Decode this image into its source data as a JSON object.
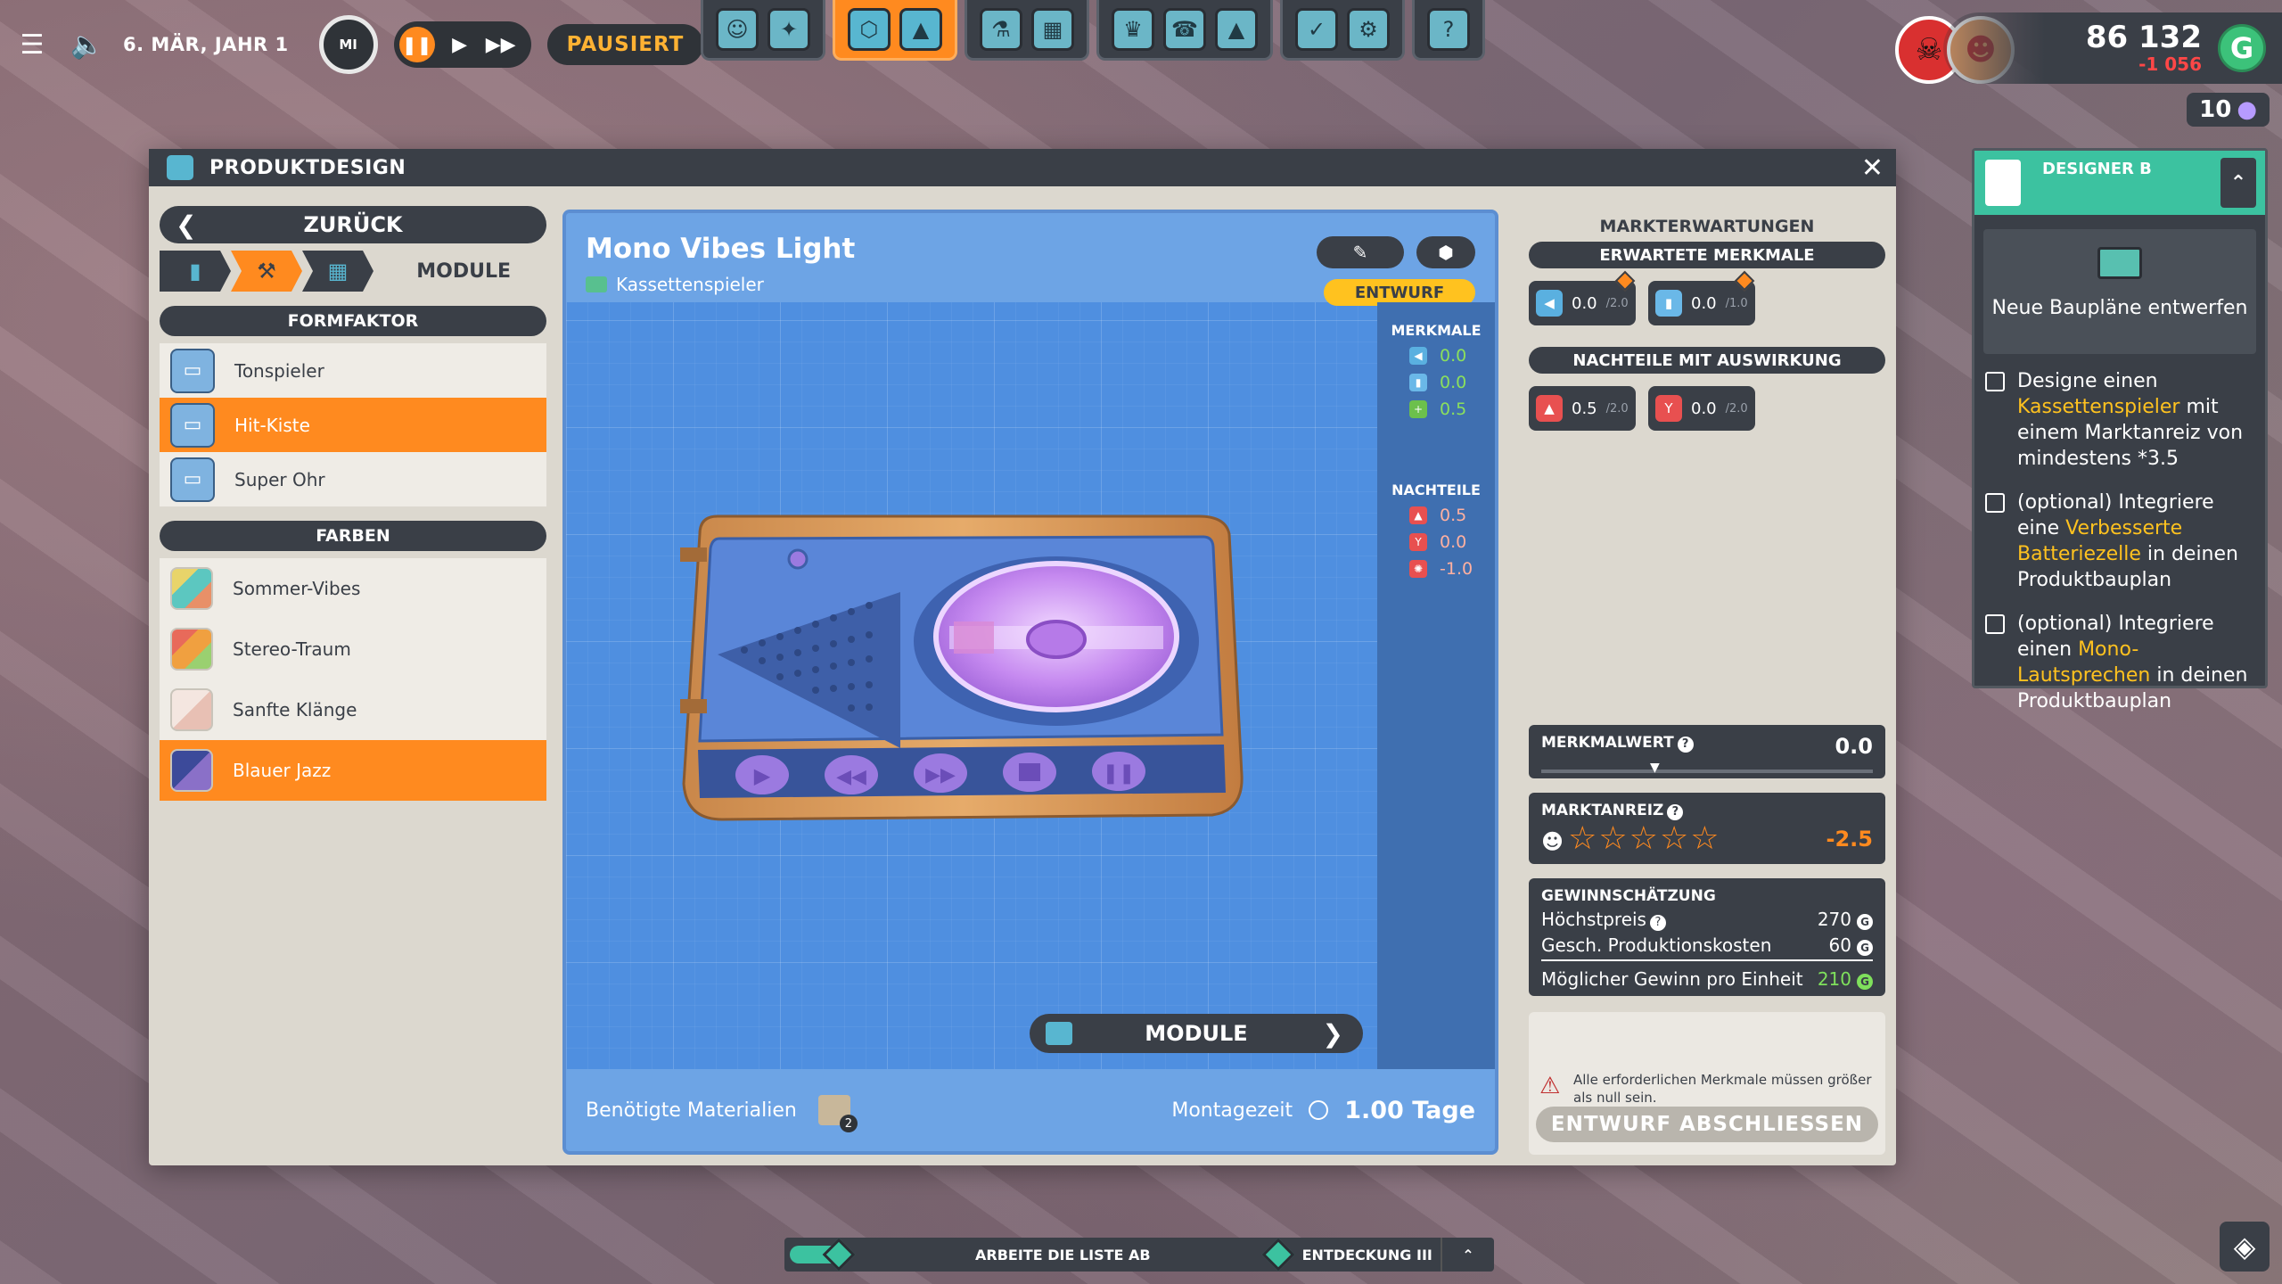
{
  "topbar": {
    "date": "6. MÄR, JAHR 1",
    "day": "MI",
    "paused_label": "PAUSIERT",
    "money": "86 132",
    "money_delta": "-1 056",
    "currency": "G",
    "mood": "10"
  },
  "window": {
    "title": "PRODUKTDESIGN"
  },
  "left": {
    "back": "ZURÜCK",
    "modes_label": "MODULE",
    "formfactor_head": "FORMFAKTOR",
    "formfactors": [
      {
        "label": "Tonspieler"
      },
      {
        "label": "Hit-Kiste"
      },
      {
        "label": "Super Ohr"
      }
    ],
    "colors_head": "FARBEN",
    "colors": [
      {
        "label": "Sommer-Vibes"
      },
      {
        "label": "Stereo-Traum"
      },
      {
        "label": "Sanfte Klänge"
      },
      {
        "label": "Blauer Jazz"
      }
    ]
  },
  "product": {
    "name": "Mono Vibes Light",
    "type": "Kassettenspieler",
    "status": "ENTWURF",
    "features_title": "MERKMALE",
    "features": [
      "0.0",
      "0.0",
      "0.5"
    ],
    "drawbacks_title": "NACHTEILE",
    "drawbacks": [
      "0.5",
      "0.0",
      "-1.0"
    ],
    "modules_btn": "MODULE",
    "materials_label": "Benötigte Materialien",
    "materials_count": "2",
    "assembly_label": "Montagezeit",
    "assembly_value": "1.00 Tage"
  },
  "market": {
    "title": "MARKTERWARTUNGEN",
    "expected_head": "ERWARTETE MERKMALE",
    "expected": [
      {
        "val": "0.0",
        "max": "/2.0"
      },
      {
        "val": "0.0",
        "max": "/1.0"
      }
    ],
    "drawbacks_head": "NACHTEILE MIT AUSWIRKUNG",
    "drawbacks": [
      {
        "val": "0.5",
        "max": "/2.0"
      },
      {
        "val": "0.0",
        "max": "/2.0"
      }
    ],
    "feature_value_label": "MERKMALWERT",
    "feature_value": "0.0",
    "appeal_label": "MARKTANREIZ",
    "appeal_value": "-2.5",
    "appeal_stars": 0,
    "profit_head": "GEWINNSCHÄTZUNG",
    "max_price_label": "Höchstpreis",
    "max_price": "270",
    "prod_cost_label": "Gesch. Produktionskosten",
    "prod_cost": "60",
    "profit_label": "Möglicher Gewinn pro Einheit",
    "profit": "210",
    "warning": "Alle erforderlichen Merkmale müssen größer als null sein.",
    "finish_btn": "ENTWURF ABSCHLIESSEN"
  },
  "quest": {
    "title": "DESIGNER B",
    "main": "Neue Baupläne entwerfen",
    "t1a": "Designe einen ",
    "t1b": "Kassettenspieler",
    "t1c": " mit einem Marktanreiz von mindestens *3.5",
    "t2a": "(optional) Integriere eine ",
    "t2b": "Verbesserte Batteriezelle",
    "t2c": " in deinen Produktbauplan",
    "t3a": "(optional) Integriere einen ",
    "t3b": "Mono-Lautsprechen",
    "t3c": " in deinen Produktbauplan"
  },
  "bottom": {
    "task": "ARBEITE DIE LISTE AB",
    "discovery": "ENTDECKUNG III"
  },
  "colors": {
    "accent": "#ff8a1f",
    "dark": "#3a3f47",
    "blueprint": "#4f8fe0"
  }
}
